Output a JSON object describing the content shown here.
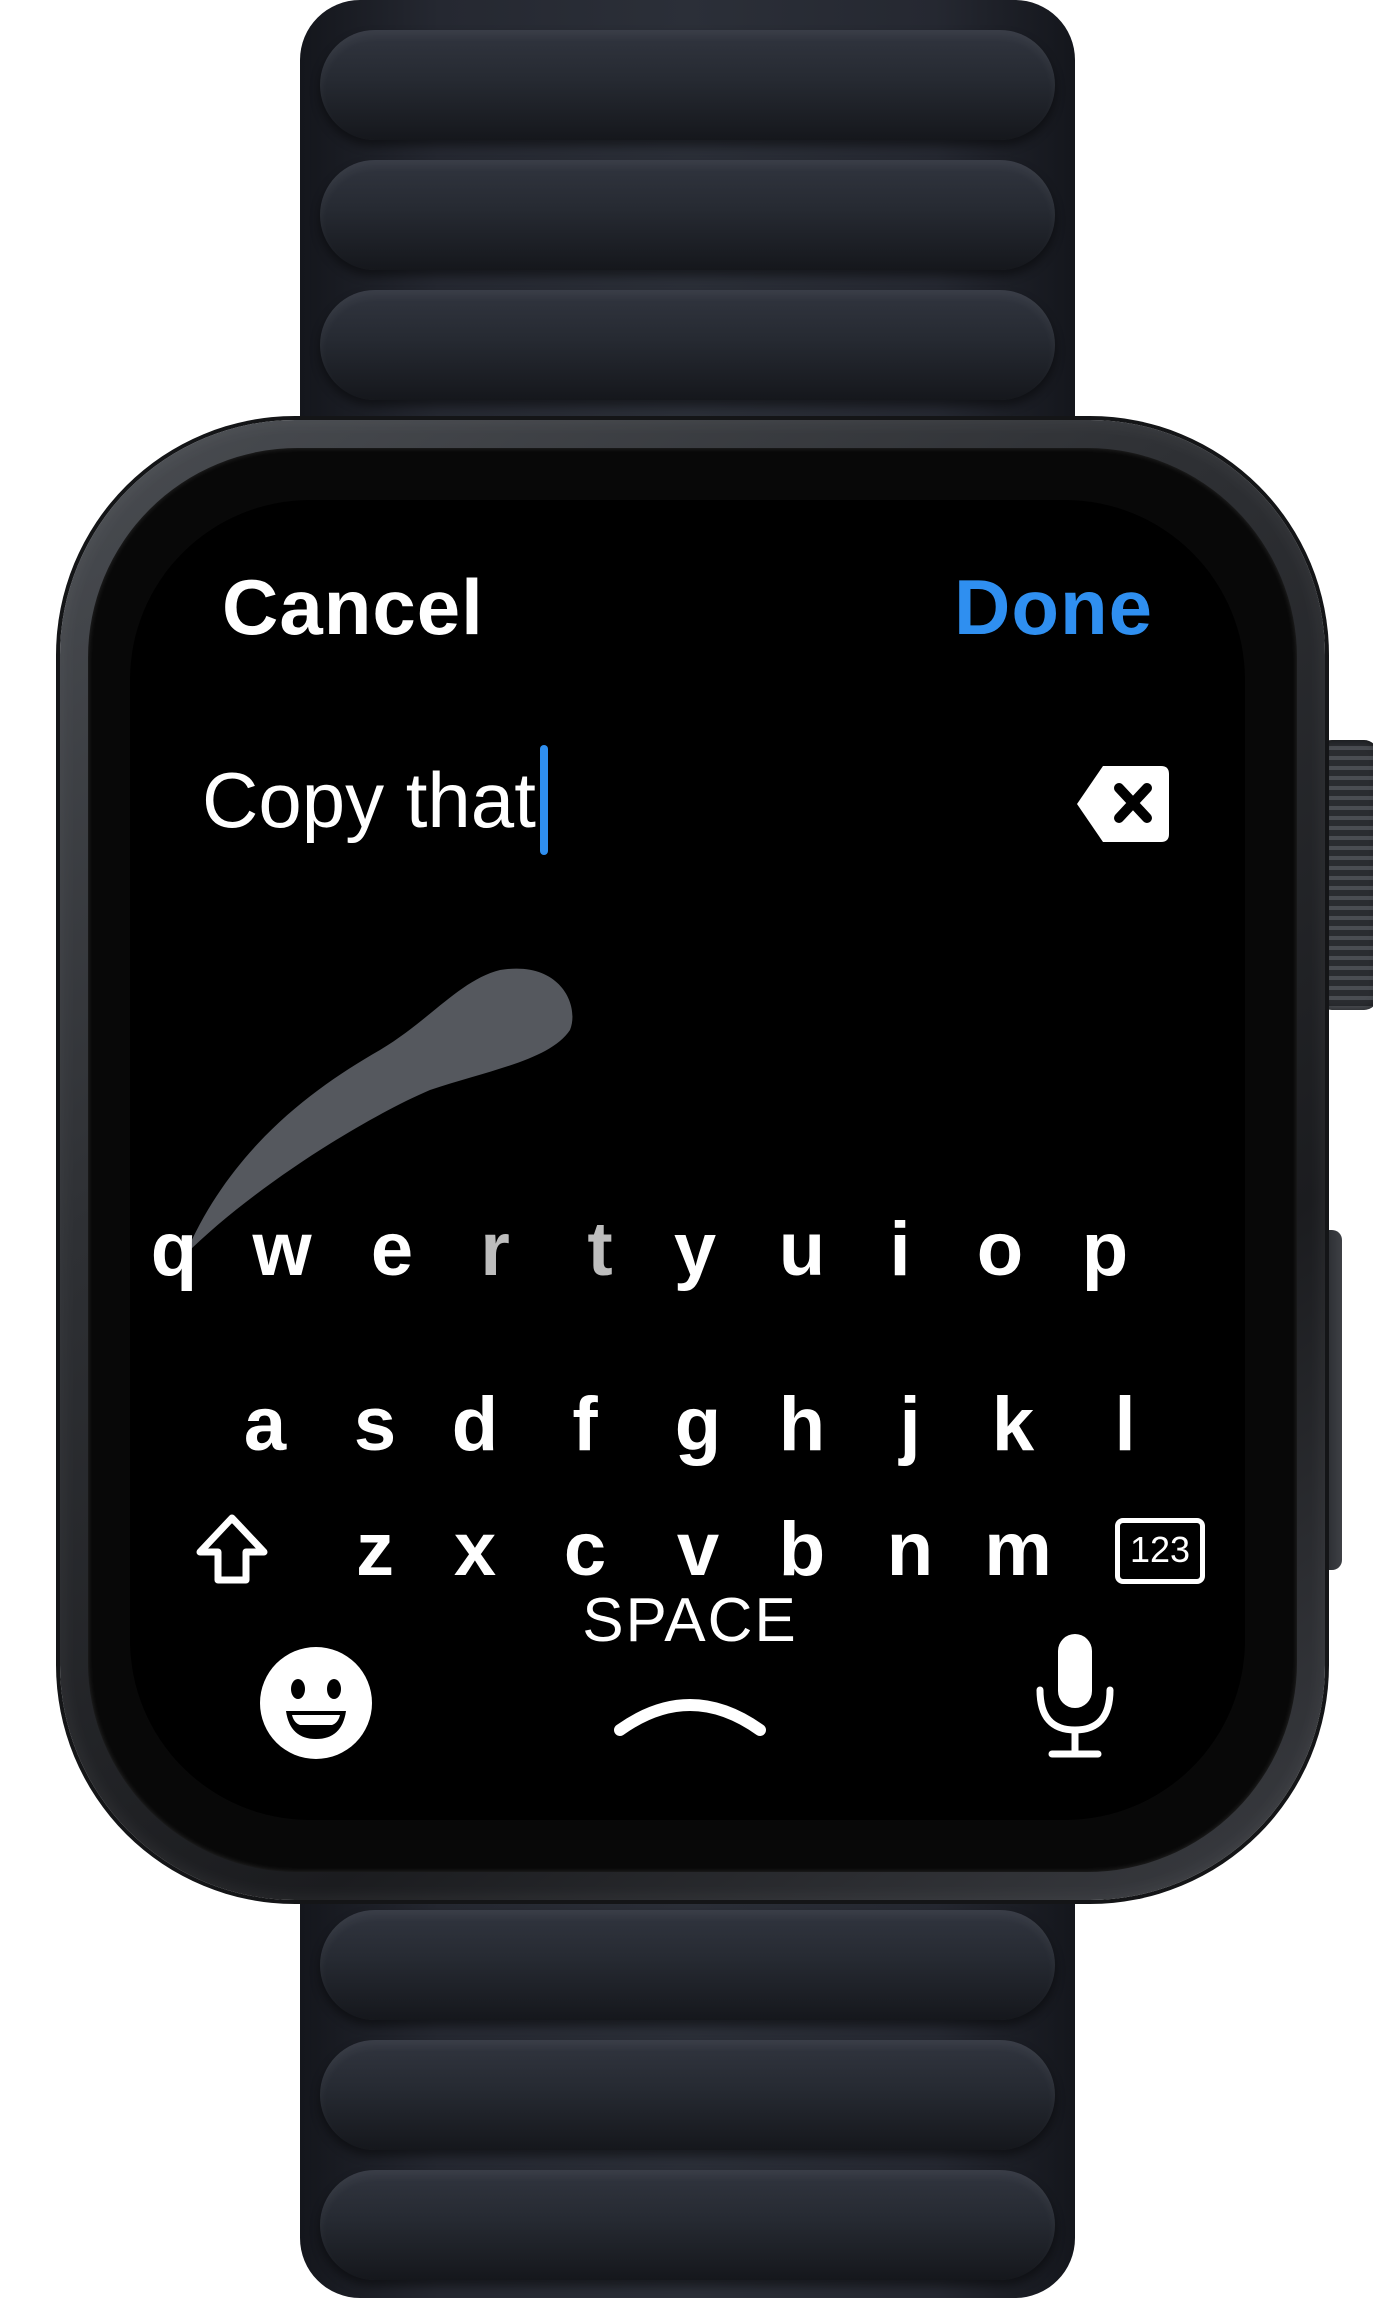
{
  "header": {
    "cancel_label": "Cancel",
    "done_label": "Done"
  },
  "input": {
    "value": "Copy that"
  },
  "keyboard": {
    "row1": [
      "q",
      "w",
      "e",
      "r",
      "t",
      "y",
      "u",
      "i",
      "o",
      "p"
    ],
    "row2": [
      "a",
      "s",
      "d",
      "f",
      "g",
      "h",
      "j",
      "k",
      "l"
    ],
    "row3": [
      "z",
      "x",
      "c",
      "v",
      "b",
      "n",
      "m"
    ],
    "numbers_label": "123",
    "space_label": "SPACE",
    "icons": {
      "shift": "shift-arrow-icon",
      "delete": "delete-backspace-icon",
      "emoji": "emoji-smile-icon",
      "dictation": "microphone-icon",
      "expand": "chevron-up-icon"
    }
  },
  "colors": {
    "accent": "#2f8ff0",
    "screen": "#000000",
    "text": "#ffffff"
  }
}
